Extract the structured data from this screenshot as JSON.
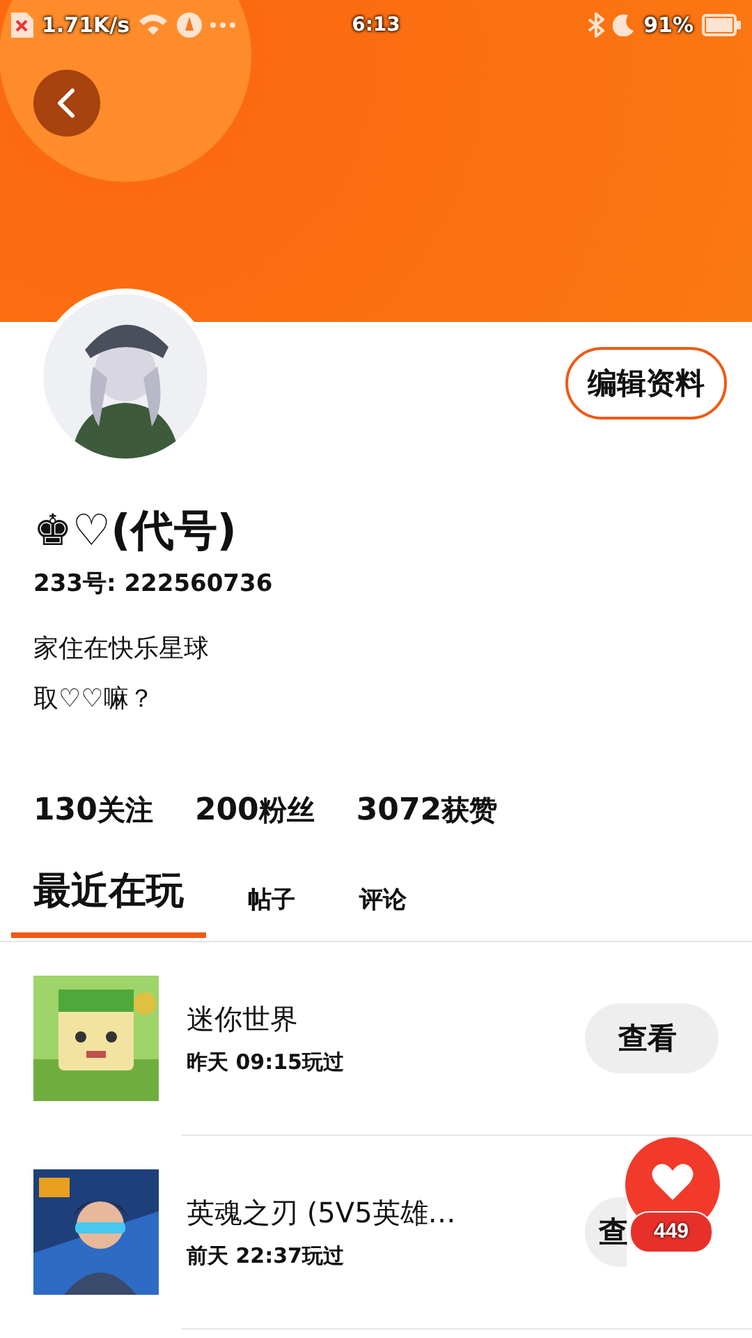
{
  "status_bar": {
    "speed": "1.71K/s",
    "time": "6:13",
    "battery": "91%"
  },
  "profile": {
    "name": "♚♡(代号)",
    "id_line": "233号: 222560736",
    "bio": [
      "家住在快乐星球",
      "取♡♡嘛？"
    ],
    "edit_button": "编辑资料"
  },
  "stats": [
    {
      "number": "130",
      "label": "关注"
    },
    {
      "number": "200",
      "label": "粉丝"
    },
    {
      "number": "3072",
      "label": "获赞"
    }
  ],
  "tabs": [
    {
      "label": "最近在玩",
      "selected": true
    },
    {
      "label": "帖子",
      "selected": false
    },
    {
      "label": "评论",
      "selected": false
    }
  ],
  "games": [
    {
      "title": "迷你世界",
      "played": "昨天 09:15玩过",
      "button": "查看"
    },
    {
      "title": "英魂之刃 (5V5英雄…",
      "played": "前天 22:37玩过",
      "button": "查",
      "covered": true
    }
  ],
  "like": {
    "count": "449"
  }
}
